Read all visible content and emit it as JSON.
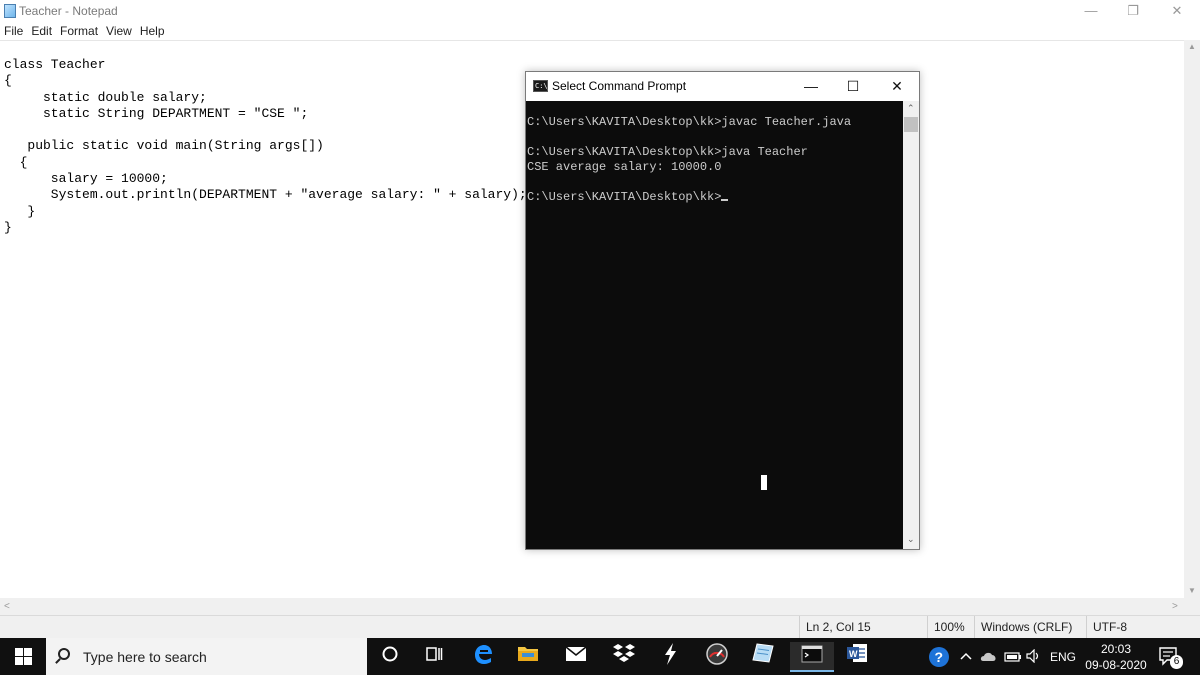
{
  "notepad": {
    "title": "Teacher - Notepad",
    "menu": [
      "File",
      "Edit",
      "Format",
      "View",
      "Help"
    ],
    "window_buttons": {
      "minimize": "—",
      "restore": "❐",
      "close": "✕"
    },
    "code_lines": [
      "class Teacher",
      "{",
      "     static double salary;",
      "     static String DEPARTMENT = \"CSE \";",
      "",
      "   public static void main(String args[])",
      "  {",
      "      salary = 10000;",
      "      System.out.println(DEPARTMENT + \"average salary: \" + salary);",
      "   }",
      "}"
    ],
    "status": {
      "position": "Ln 2, Col 15",
      "zoom": "100%",
      "line_ending": "Windows (CRLF)",
      "encoding": "UTF-8"
    }
  },
  "cmd": {
    "title": "Select Command Prompt",
    "icon_label": "C:\\_",
    "window_buttons": {
      "minimize": "—",
      "maximize": "☐",
      "close": "✕"
    },
    "lines": [
      "",
      "C:\\Users\\KAVITA\\Desktop\\kk>javac Teacher.java",
      "",
      "C:\\Users\\KAVITA\\Desktop\\kk>java Teacher",
      "CSE average salary: 10000.0",
      "",
      "C:\\Users\\KAVITA\\Desktop\\kk>"
    ]
  },
  "taskbar": {
    "search_placeholder": "Type here to search",
    "icons": [
      "cortana-icon",
      "task-view-icon",
      "edge-icon",
      "file-explorer-icon",
      "mail-icon",
      "dropbox-icon",
      "lightning-app-icon",
      "speedometer-app-icon",
      "paper-app-icon",
      "command-prompt-icon",
      "word-icon"
    ],
    "tray": {
      "language": "ENG",
      "time": "20:03",
      "date": "09-08-2020",
      "notification_count": "6"
    },
    "colors": {
      "taskbar_bg": "#101010",
      "edge_blue": "#1e90ff",
      "word_blue": "#2b579a"
    }
  }
}
